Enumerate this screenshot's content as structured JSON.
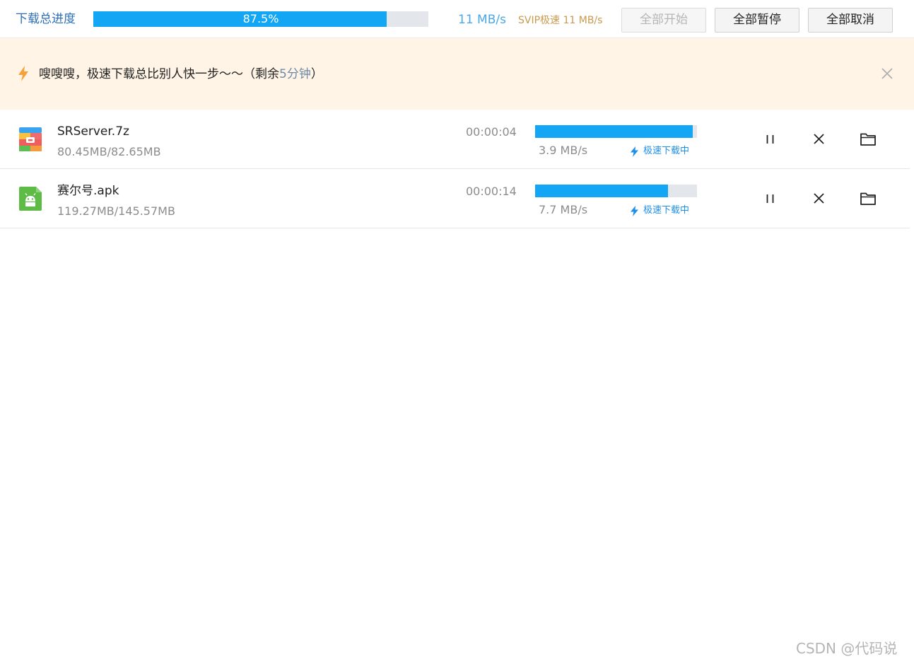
{
  "toolbar": {
    "total_label": "下载总进度",
    "total_progress_fraction": 0.875,
    "total_progress_text": "87.5%",
    "speed": "11 MB/s",
    "svip_speed": "SVIP极速 11 MB/s",
    "start_all_label": "全部开始",
    "start_all_enabled": false,
    "pause_all_label": "全部暂停",
    "cancel_all_label": "全部取消"
  },
  "banner": {
    "icon": "lightning-icon",
    "text": "嗖嗖嗖，极速下载总比别人快一步～～（剩余",
    "remaining": "5分钟",
    "text_end": "）",
    "close_icon": "close-icon"
  },
  "downloads": [
    {
      "icon": "archive-file-icon",
      "name": "SRServer.7z",
      "size": "80.45MB/82.65MB",
      "eta": "00:00:04",
      "progress_fraction": 0.9734,
      "speed": "3.9 MB/s",
      "mode": "极速下载中"
    },
    {
      "icon": "android-apk-icon",
      "name": "赛尔号.apk",
      "size": "119.27MB/145.57MB",
      "eta": "00:00:14",
      "progress_fraction": 0.8194,
      "speed": "7.7 MB/s",
      "mode": "极速下载中"
    }
  ],
  "watermark": "CSDN @代码说",
  "colors": {
    "progress": "#13a6f5",
    "track": "#e3e6ea",
    "banner_bg": "#fff4e5",
    "accent_orange": "#f5a23a",
    "svip_gold": "#c99a4d"
  }
}
